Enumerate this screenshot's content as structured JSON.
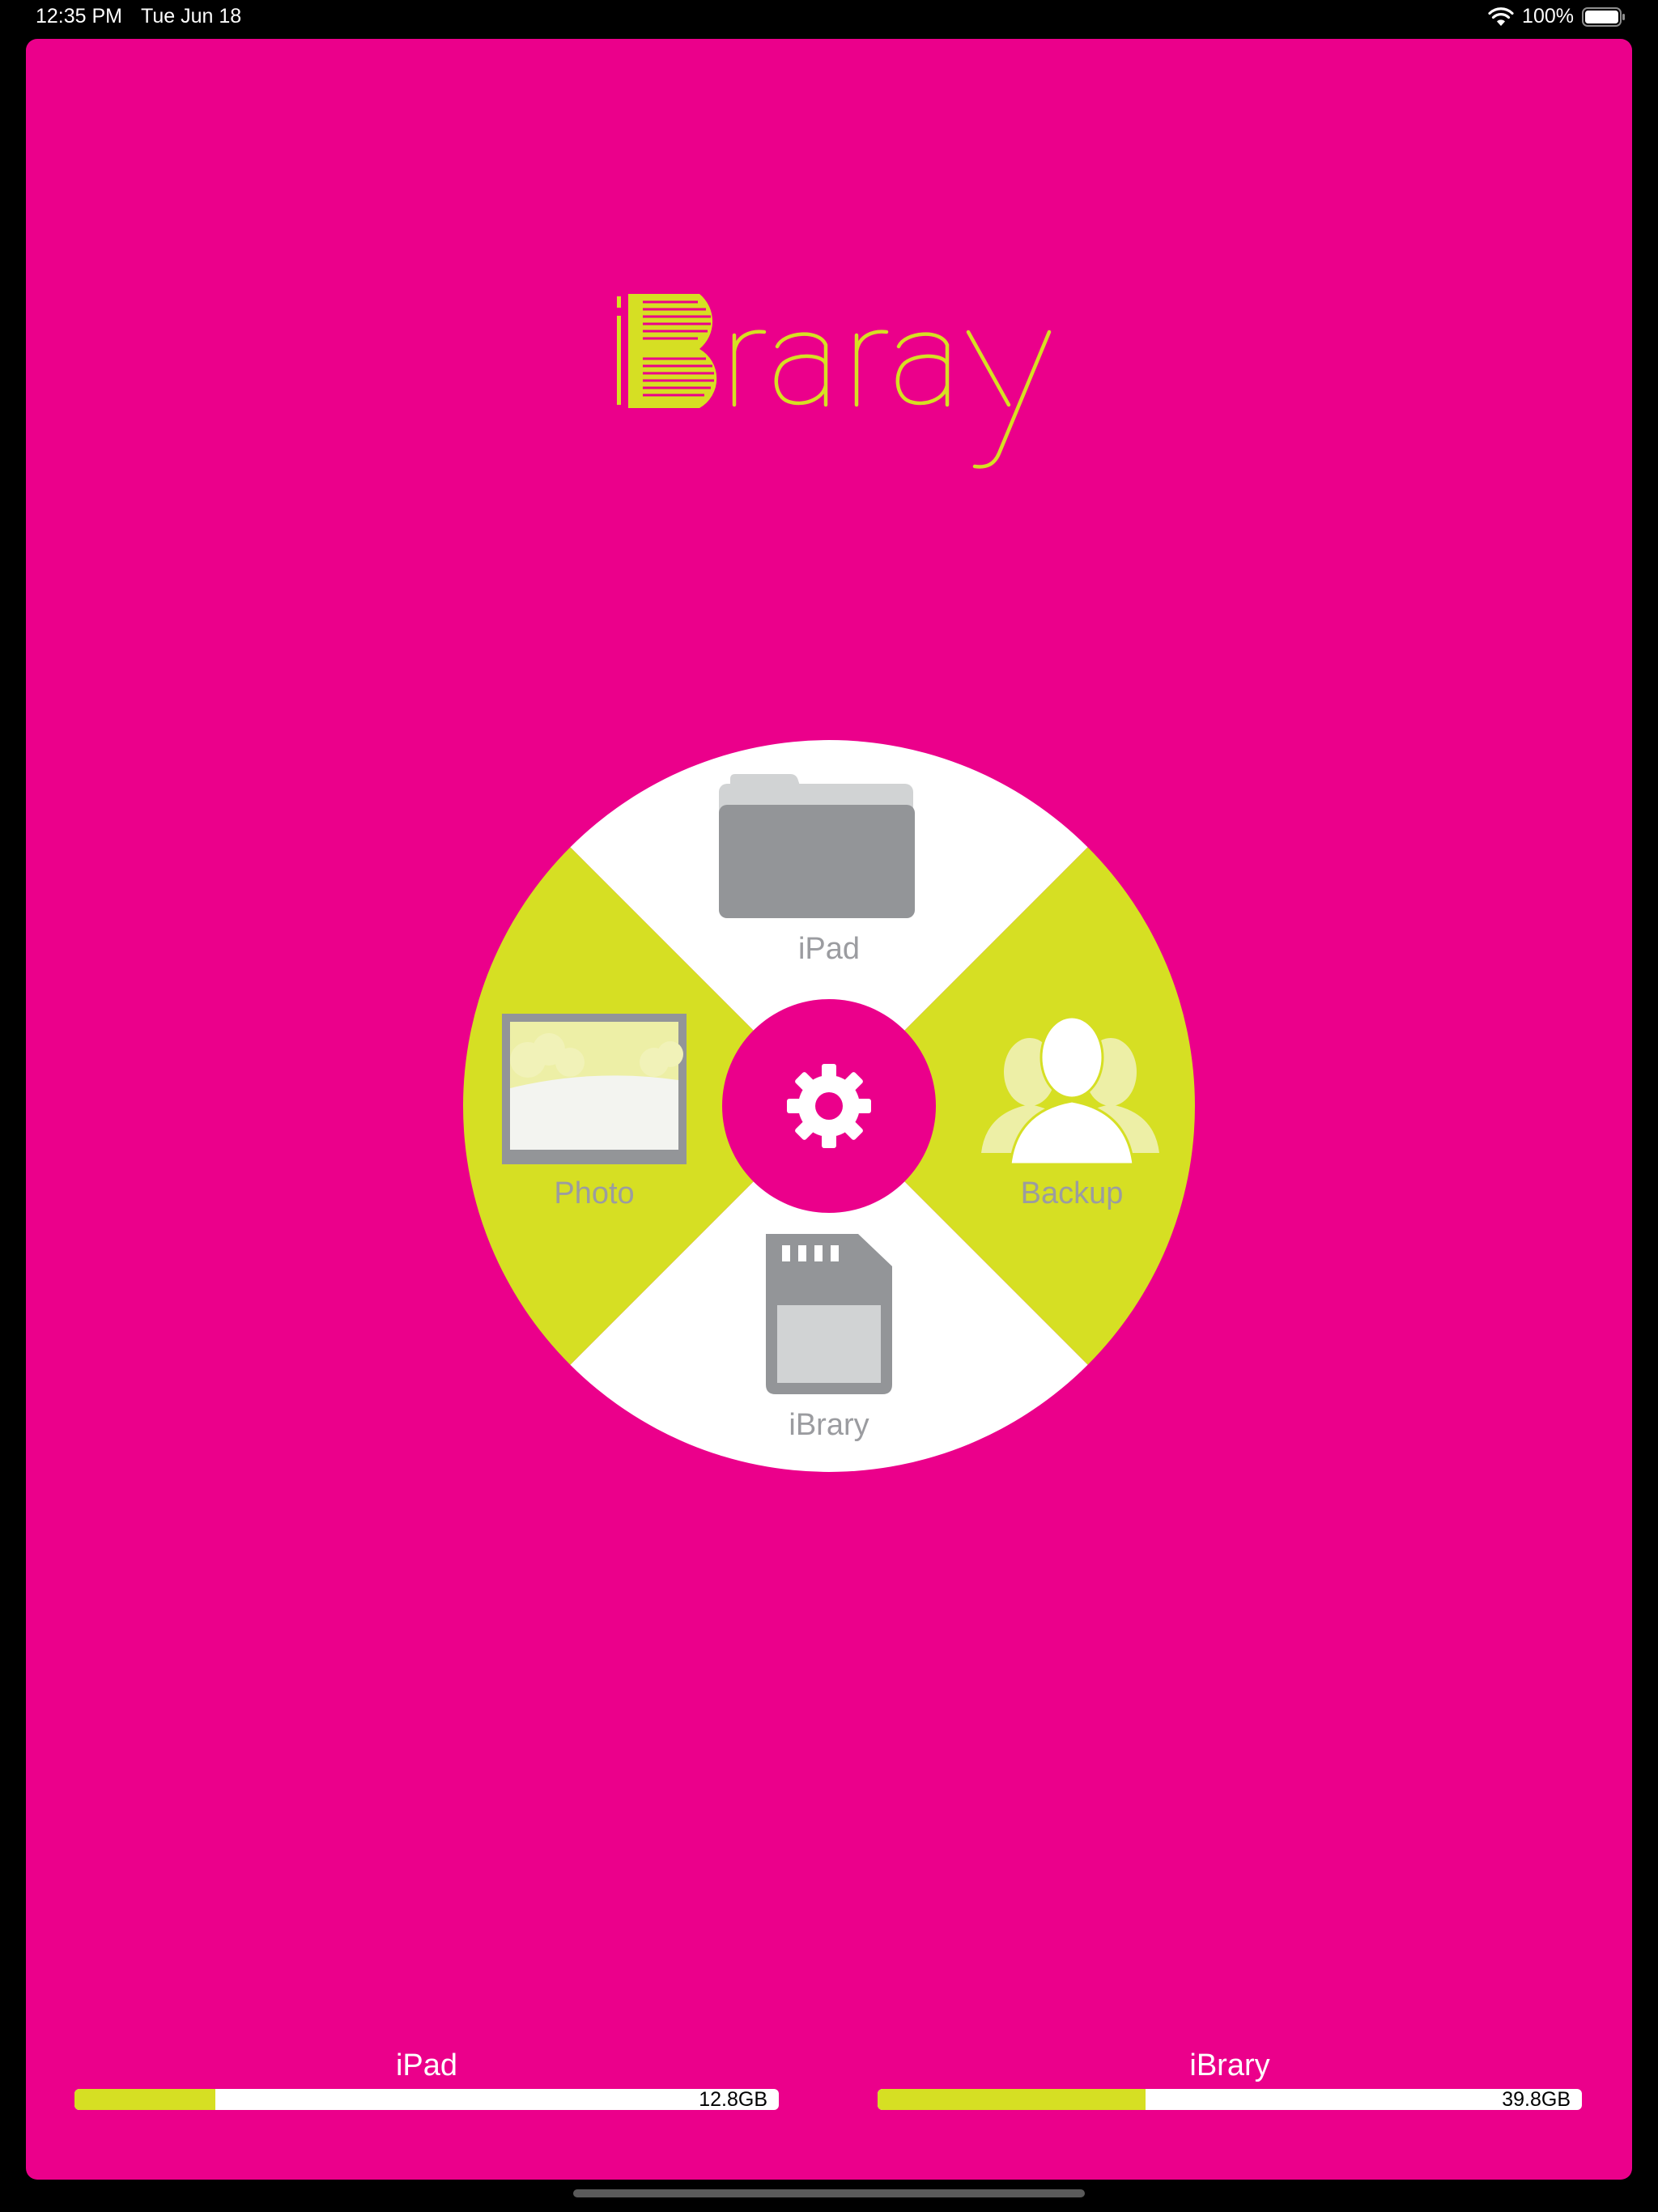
{
  "status_bar": {
    "time": "12:35 PM",
    "date": "Tue Jun 18",
    "battery": "100%"
  },
  "app": {
    "logo_text": "iBrary",
    "brand_color": "#EB008B",
    "accent_color": "#D6DF23"
  },
  "menu": {
    "top": {
      "label": "iPad",
      "icon": "folder-icon"
    },
    "left": {
      "label": "Photo",
      "icon": "photo-icon"
    },
    "right": {
      "label": "Backup",
      "icon": "people-icon"
    },
    "bottom": {
      "label": "iBrary",
      "icon": "sd-card-icon"
    },
    "center": {
      "icon": "gear-icon"
    }
  },
  "storage": [
    {
      "title": "iPad",
      "value": "12.8GB",
      "fill_fraction": 0.2
    },
    {
      "title": "iBrary",
      "value": "39.8GB",
      "fill_fraction": 0.38
    }
  ]
}
